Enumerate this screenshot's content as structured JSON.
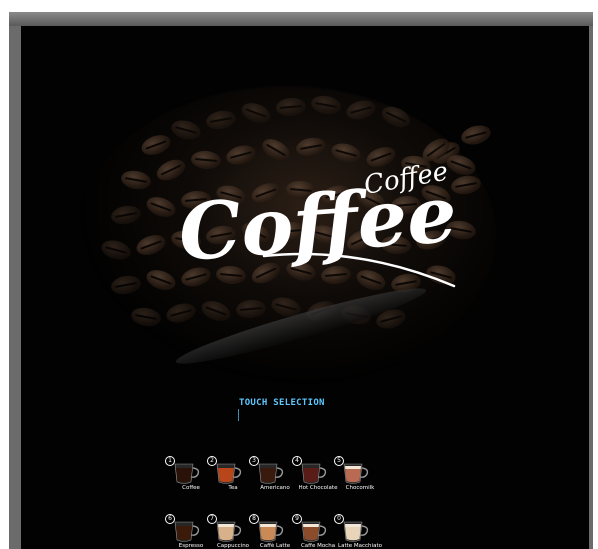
{
  "logo": {
    "main_text": "Coffee",
    "script_text": "Coffee"
  },
  "prompt": "TOUCH SELECTION",
  "drinks": [
    {
      "number": "1",
      "name": "Coffee",
      "icon": "coffee-cup-icon",
      "color": "#2b1209"
    },
    {
      "number": "2",
      "name": "Tea",
      "icon": "tea-cup-icon",
      "color": "#b8461a"
    },
    {
      "number": "3",
      "name": "Americano",
      "icon": "americano-cup-icon",
      "color": "#3a1a0c"
    },
    {
      "number": "4",
      "name": "Hot Chocolate",
      "icon": "hot-chocolate-cup-icon",
      "color": "#5a1c16"
    },
    {
      "number": "5",
      "name": "Chocomilk",
      "icon": "chocomilk-cup-icon",
      "color": "#b86a52"
    },
    {
      "number": "6",
      "name": "Espresso",
      "icon": "espresso-cup-icon",
      "color": "#3b1a0a"
    },
    {
      "number": "7",
      "name": "Cappuccino",
      "icon": "cappuccino-cup-icon",
      "color": "#d8b08a"
    },
    {
      "number": "8",
      "name": "Caffè Latte",
      "icon": "caffe-latte-cup-icon",
      "color": "#c98a56"
    },
    {
      "number": "9",
      "name": "Caffe Mocha",
      "icon": "caffe-mocha-cup-icon",
      "color": "#8a4c2a"
    },
    {
      "number": "0",
      "name": "Latte Macchiato",
      "icon": "latte-macchiato-cup-icon",
      "color": "#e8d4b8"
    }
  ]
}
